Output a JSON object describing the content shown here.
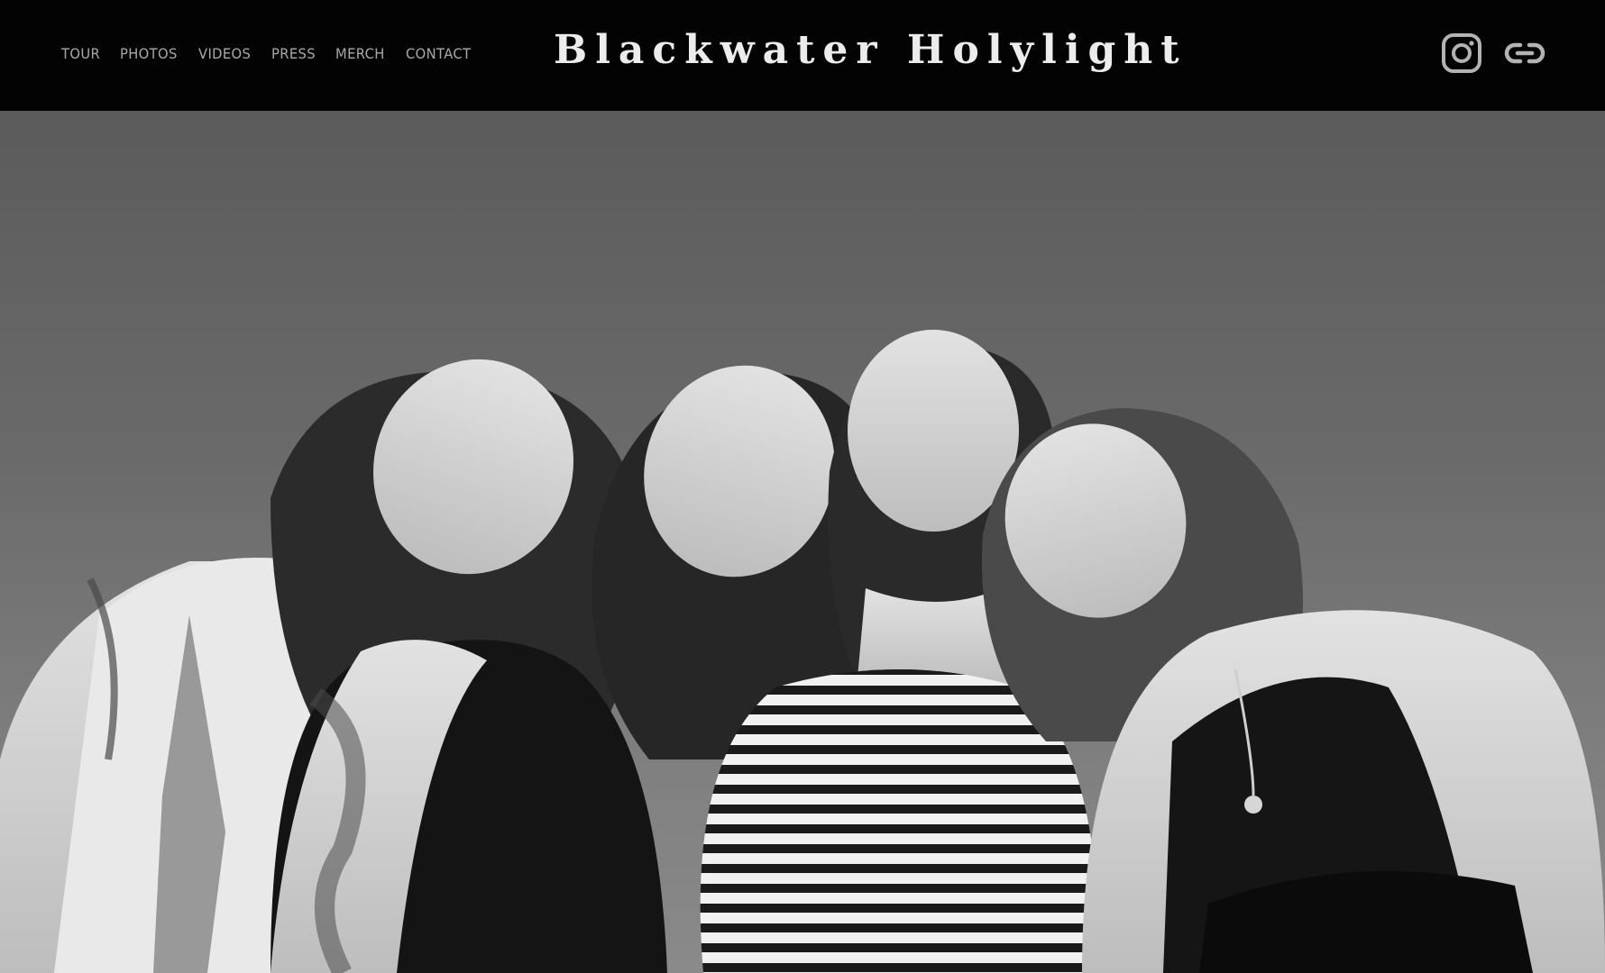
{
  "site": {
    "title": "Blackwater Holylight"
  },
  "nav": {
    "items": [
      {
        "label": "TOUR"
      },
      {
        "label": "PHOTOS"
      },
      {
        "label": "VIDEOS"
      },
      {
        "label": "PRESS"
      },
      {
        "label": "MERCH"
      },
      {
        "label": "CONTACT"
      }
    ]
  },
  "social": {
    "icons": [
      "instagram-icon",
      "link-icon"
    ]
  },
  "hero": {
    "description_color_bg": "#6a6a6a"
  },
  "colors": {
    "header_bg": "#030303",
    "nav_text": "#a9a9a9",
    "logo_text": "#ececec",
    "icon_color": "#b3b3b3"
  }
}
